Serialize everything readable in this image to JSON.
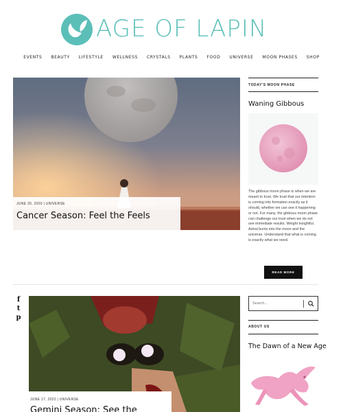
{
  "brand": {
    "logo_text": "AGE OF LAPIN",
    "accent": "#5bbfb8"
  },
  "nav": [
    "EVENTS",
    "BEAUTY",
    "LIFESTYLE",
    "WELLNESS",
    "CRYSTALS",
    "PLANTS",
    "FOOD",
    "UNIVERSE",
    "MOON PHASES",
    "SHOP"
  ],
  "posts": [
    {
      "meta": "JUNE 20, 2020  |  UNIVERSE",
      "title": "Cancer Season: Feel the Feels"
    },
    {
      "meta": "JUNE 17, 2022  |  UNIVERSE",
      "title": "Gemini Season: See the"
    }
  ],
  "sidebar": {
    "moon_heading": "TODAY'S MOON PHASE",
    "moon_phase": "Waning Gibbous",
    "moon_description": "The gibbous moon phase is when we are meant to trust. We trust that our intention is coming into formation exactly as it should, whether we can see it happening or not. For many, the gibbous moon phase can challenge our trust when we do not see immediate results. Weight insightful. Astral bunts into the moon and the universe. Understand that what is coming is exactly what we need.",
    "read_more": "READ MORE",
    "search_placeholder": "Search...",
    "about_heading": "ABOUT US",
    "about_title": "The Dawn of a New Age"
  },
  "share": [
    "f",
    "t",
    "p"
  ]
}
